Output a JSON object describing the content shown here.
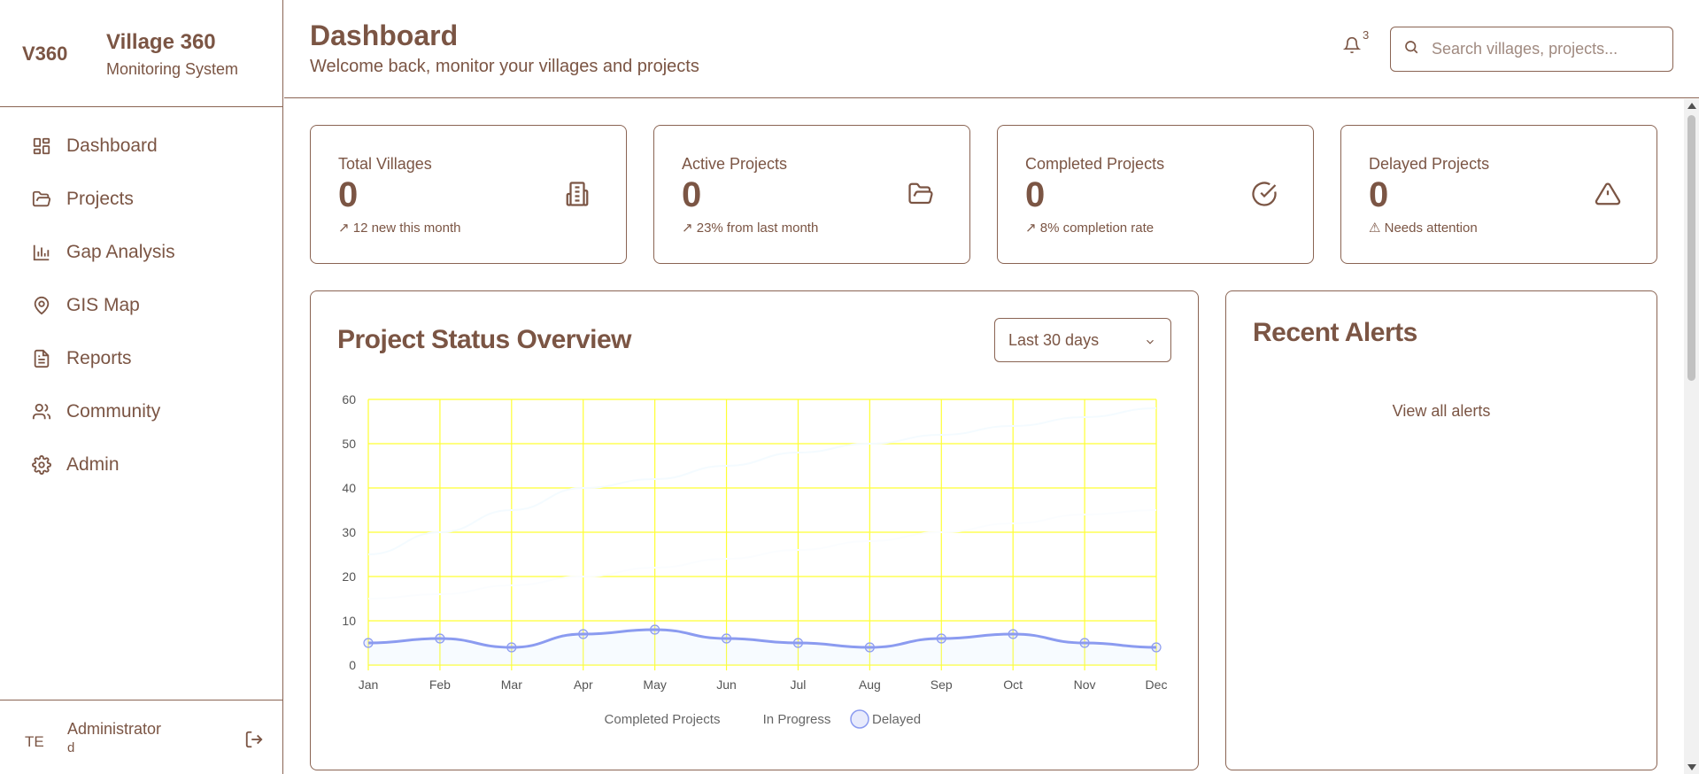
{
  "brand": {
    "logo": "V360",
    "title": "Village 360",
    "subtitle": "Monitoring System"
  },
  "nav": [
    {
      "label": "Dashboard",
      "icon": "dashboard-grid-icon"
    },
    {
      "label": "Projects",
      "icon": "folder-icon"
    },
    {
      "label": "Gap Analysis",
      "icon": "bar-chart-icon"
    },
    {
      "label": "GIS Map",
      "icon": "map-pin-icon"
    },
    {
      "label": "Reports",
      "icon": "document-icon"
    },
    {
      "label": "Community",
      "icon": "users-icon"
    },
    {
      "label": "Admin",
      "icon": "gear-icon"
    }
  ],
  "user": {
    "initials": "TE",
    "name": "Administrator",
    "role": "d"
  },
  "header": {
    "title": "Dashboard",
    "subtitle": "Welcome back, monitor your villages and projects",
    "notification_count": "3",
    "search_placeholder": "Search villages, projects..."
  },
  "stats": [
    {
      "label": "Total Villages",
      "value": "0",
      "note": "↗ 12 new this month",
      "icon": "building-icon"
    },
    {
      "label": "Active Projects",
      "value": "0",
      "note": "↗ 23% from last month",
      "icon": "folder-open-icon"
    },
    {
      "label": "Completed Projects",
      "value": "0",
      "note": "↗ 8% completion rate",
      "icon": "check-circle-icon"
    },
    {
      "label": "Delayed Projects",
      "value": "0",
      "note": "⚠ Needs attention",
      "icon": "warning-triangle-icon"
    }
  ],
  "chart_panel": {
    "title": "Project Status Overview",
    "range": "Last 30 days"
  },
  "alerts_panel": {
    "title": "Recent Alerts",
    "view_all": "View all alerts"
  },
  "colors": {
    "text": "#7b5544",
    "border": "#8a6453",
    "grid": "#ffff33",
    "delayed_line": "#8b9bf0"
  },
  "chart_data": {
    "type": "line",
    "categories": [
      "Jan",
      "Feb",
      "Mar",
      "Apr",
      "May",
      "Jun",
      "Jul",
      "Aug",
      "Sep",
      "Oct",
      "Nov",
      "Dec"
    ],
    "ylim": [
      0,
      60
    ],
    "yticks": [
      "0",
      "10",
      "20",
      "30",
      "40",
      "50",
      "60"
    ],
    "grid": true,
    "legend_placement": "bottom",
    "series": [
      {
        "name": "Completed Projects",
        "values": [
          25,
          30,
          35,
          40,
          42,
          45,
          48,
          50,
          52,
          54,
          56,
          58
        ]
      },
      {
        "name": "In Progress",
        "values": [
          15,
          16,
          18,
          20,
          22,
          24,
          26,
          28,
          30,
          32,
          34,
          35
        ]
      },
      {
        "name": "Delayed",
        "values": [
          5,
          6,
          4,
          7,
          8,
          6,
          5,
          4,
          6,
          7,
          5,
          4
        ]
      }
    ]
  }
}
